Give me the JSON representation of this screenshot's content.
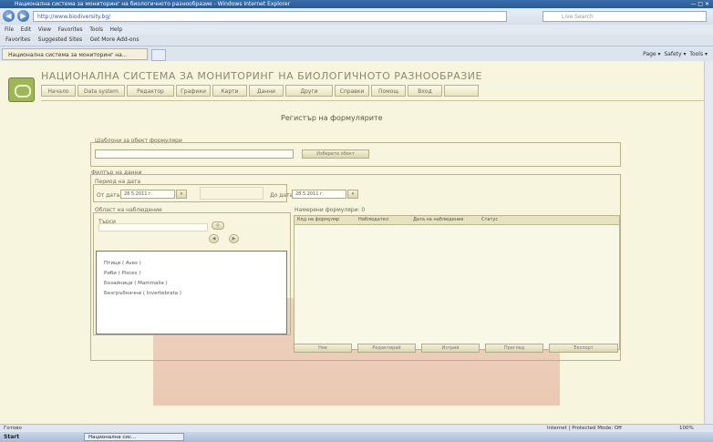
{
  "browser": {
    "window_title": "Национална система за мониторинг на биологичното разнообразие - Windows Internet Explorer",
    "address": "http://www.biodiversity.bg/",
    "search_placeholder": "Live Search",
    "menu": [
      "File",
      "Edit",
      "View",
      "Favorites",
      "Tools",
      "Help"
    ],
    "favorites_label": "Favorites",
    "favorites_links": [
      "Suggested Sites",
      "Get More Add-ons"
    ],
    "tab_title": "Национална система за мониторинг на...",
    "command_bar": [
      "Page",
      "Safety",
      "Tools"
    ]
  },
  "site": {
    "title": "НАЦИОНАЛНА СИСТЕМА ЗА МОНИТОРИНГ НА БИОЛОГИЧНОТО РАЗНООБРАЗИЕ",
    "nav": [
      "Начало",
      "Data system",
      "Редактор",
      "Графики",
      "Карти",
      "Данни",
      "Други",
      "Справки",
      "Помощ",
      "Вход"
    ],
    "heading": "Регистър на формулярите"
  },
  "form": {
    "object_group_label": "Шаблони за обект формуляри",
    "object_button": "Изберете обект",
    "search_group_label": "Филтър на данни",
    "date_label": "Период на дата",
    "date_from_label": "От дата",
    "date_from_value": "28.5.2011 г.",
    "date_to_label": "До дата",
    "date_to_value": "28.5.2011 г.",
    "area_label": "Област на наблюдение",
    "area_search_label": "Търси",
    "results_label": "Намерени формуляри: 0",
    "list_items": [
      "Птици ( Aves )",
      "Риби ( Pisces )",
      "Бозайници ( Mammalia )",
      "Безгръбначни ( Invertebrata )"
    ],
    "grid_columns": [
      "Код на формуляр",
      "Наблюдател",
      "Дата на наблюдение",
      "Статус"
    ],
    "footer_buttons": [
      "Нов",
      "Редактирай",
      "Изтрий",
      "Преглед",
      "Експорт"
    ]
  },
  "status": {
    "left": "Готово",
    "zone": "Internet | Protected Mode: Off",
    "zoom": "100%"
  },
  "taskbar": {
    "start": "Start",
    "task": "Национална сис..."
  }
}
